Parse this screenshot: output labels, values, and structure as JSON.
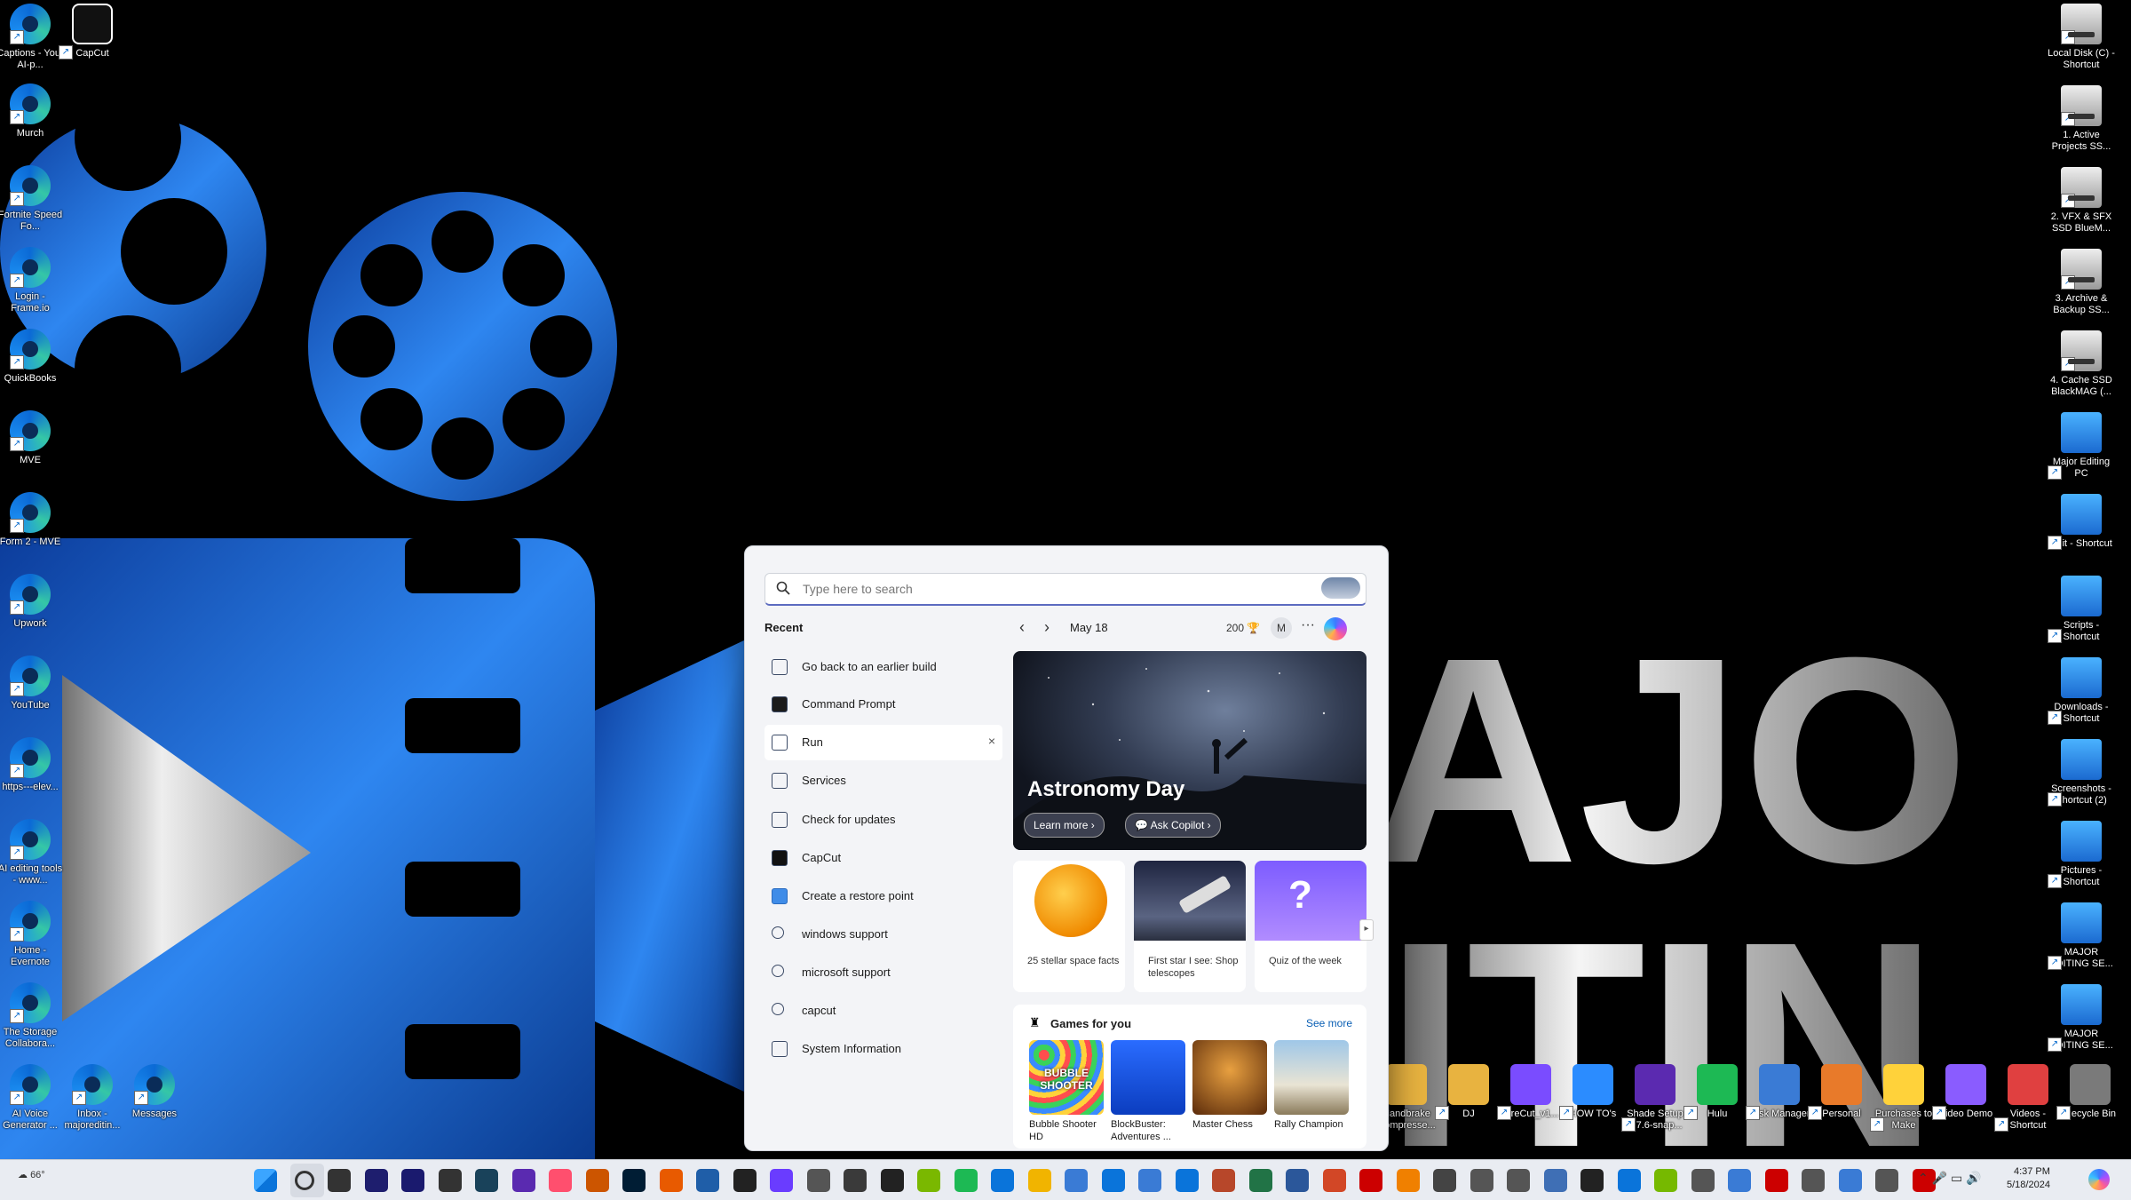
{
  "search": {
    "placeholder": "Type here to search"
  },
  "recent": {
    "title": "Recent",
    "items": [
      {
        "label": "Go back to an earlier build",
        "icon": "restore-icon"
      },
      {
        "label": "Command Prompt",
        "icon": "terminal-icon"
      },
      {
        "label": "Run",
        "icon": "run-icon"
      },
      {
        "label": "Services",
        "icon": "gears-icon"
      },
      {
        "label": "Check for updates",
        "icon": "update-icon"
      },
      {
        "label": "CapCut",
        "icon": "capcut-icon"
      },
      {
        "label": "Create a restore point",
        "icon": "monitor-icon"
      },
      {
        "label": "windows support",
        "icon": "search-icon"
      },
      {
        "label": "microsoft support",
        "icon": "search-icon"
      },
      {
        "label": "capcut",
        "icon": "search-icon"
      },
      {
        "label": "System Information",
        "icon": "system-info-icon"
      }
    ],
    "close_glyph": "×"
  },
  "highlights": {
    "prev": "‹",
    "next": "›",
    "date": "May 18",
    "points": "200",
    "avatar": "M",
    "more": "···",
    "hero": {
      "title": "Astronomy Day",
      "learn_more": "Learn more",
      "ask_copilot": "Ask Copilot"
    },
    "cards": [
      {
        "text": "25 stellar space facts"
      },
      {
        "text": "First star I see: Shop telescopes"
      },
      {
        "text": "Quiz of the week"
      }
    ]
  },
  "games": {
    "title": "Games for you",
    "see_more": "See more",
    "items": [
      {
        "name": "Bubble Shooter HD",
        "badge": "BUBBLE SHOOTER"
      },
      {
        "name": "BlockBuster: Adventures ..."
      },
      {
        "name": "Master Chess"
      },
      {
        "name": "Rally Champion"
      }
    ]
  },
  "desktop_left": [
    {
      "label": "Captions - Your AI-p..."
    },
    {
      "label": "CapCut"
    },
    {
      "label": "Murch"
    },
    {
      "label": "Fortnite Speed Fo..."
    },
    {
      "label": "Login - Frame.io"
    },
    {
      "label": "QuickBooks"
    },
    {
      "label": "MVE"
    },
    {
      "label": "Form 2 - MVE"
    },
    {
      "label": "Upwork"
    },
    {
      "label": "YouTube"
    },
    {
      "label": "https---elev..."
    },
    {
      "label": "AI editing tools - www..."
    },
    {
      "label": "Home - Evernote"
    },
    {
      "label": "The Storage Collabora..."
    },
    {
      "label": "AI Voice Generator ..."
    },
    {
      "label": "Inbox - majoreditin..."
    },
    {
      "label": "Messages"
    }
  ],
  "desktop_right": [
    {
      "label": "Local Disk (C) - Shortcut"
    },
    {
      "label": "1. Active Projects SS..."
    },
    {
      "label": "2. VFX & SFX SSD BlueM..."
    },
    {
      "label": "3. Archive & Backup SS..."
    },
    {
      "label": "4. Cache SSD BlackMAG (..."
    },
    {
      "label": "Major Editing PC"
    },
    {
      "label": "Edit - Shortcut"
    },
    {
      "label": "Scripts - Shortcut"
    },
    {
      "label": "Downloads - Shortcut"
    },
    {
      "label": "Screenshots - Shortcut (2)"
    },
    {
      "label": "Pictures - Shortcut"
    },
    {
      "label": "MAJOR EDITING SE..."
    },
    {
      "label": "MAJOR EDITING SE..."
    }
  ],
  "desktop_bottom": [
    {
      "label": "Handbrake Compresse..."
    },
    {
      "label": "DJ"
    },
    {
      "label": "FireCut_v1..."
    },
    {
      "label": "HOW TO's"
    },
    {
      "label": "Shade Setup 1.7.6-snap..."
    },
    {
      "label": "Hulu"
    },
    {
      "label": "Task Manager"
    },
    {
      "label": "Personal"
    },
    {
      "label": "Purchases to Make"
    },
    {
      "label": "Video Demo"
    },
    {
      "label": "Videos - Shortcut"
    },
    {
      "label": "Recycle Bin"
    }
  ],
  "wallpaper": {
    "text1": "AJO",
    "text2": "ITIN"
  },
  "taskbar": {
    "weather": "66°",
    "time": "4:37 PM",
    "date": "5/18/2024"
  },
  "colors": {
    "accent": "#1e6fff",
    "panel": "#f3f4f7",
    "link": "#0a5fb4"
  }
}
